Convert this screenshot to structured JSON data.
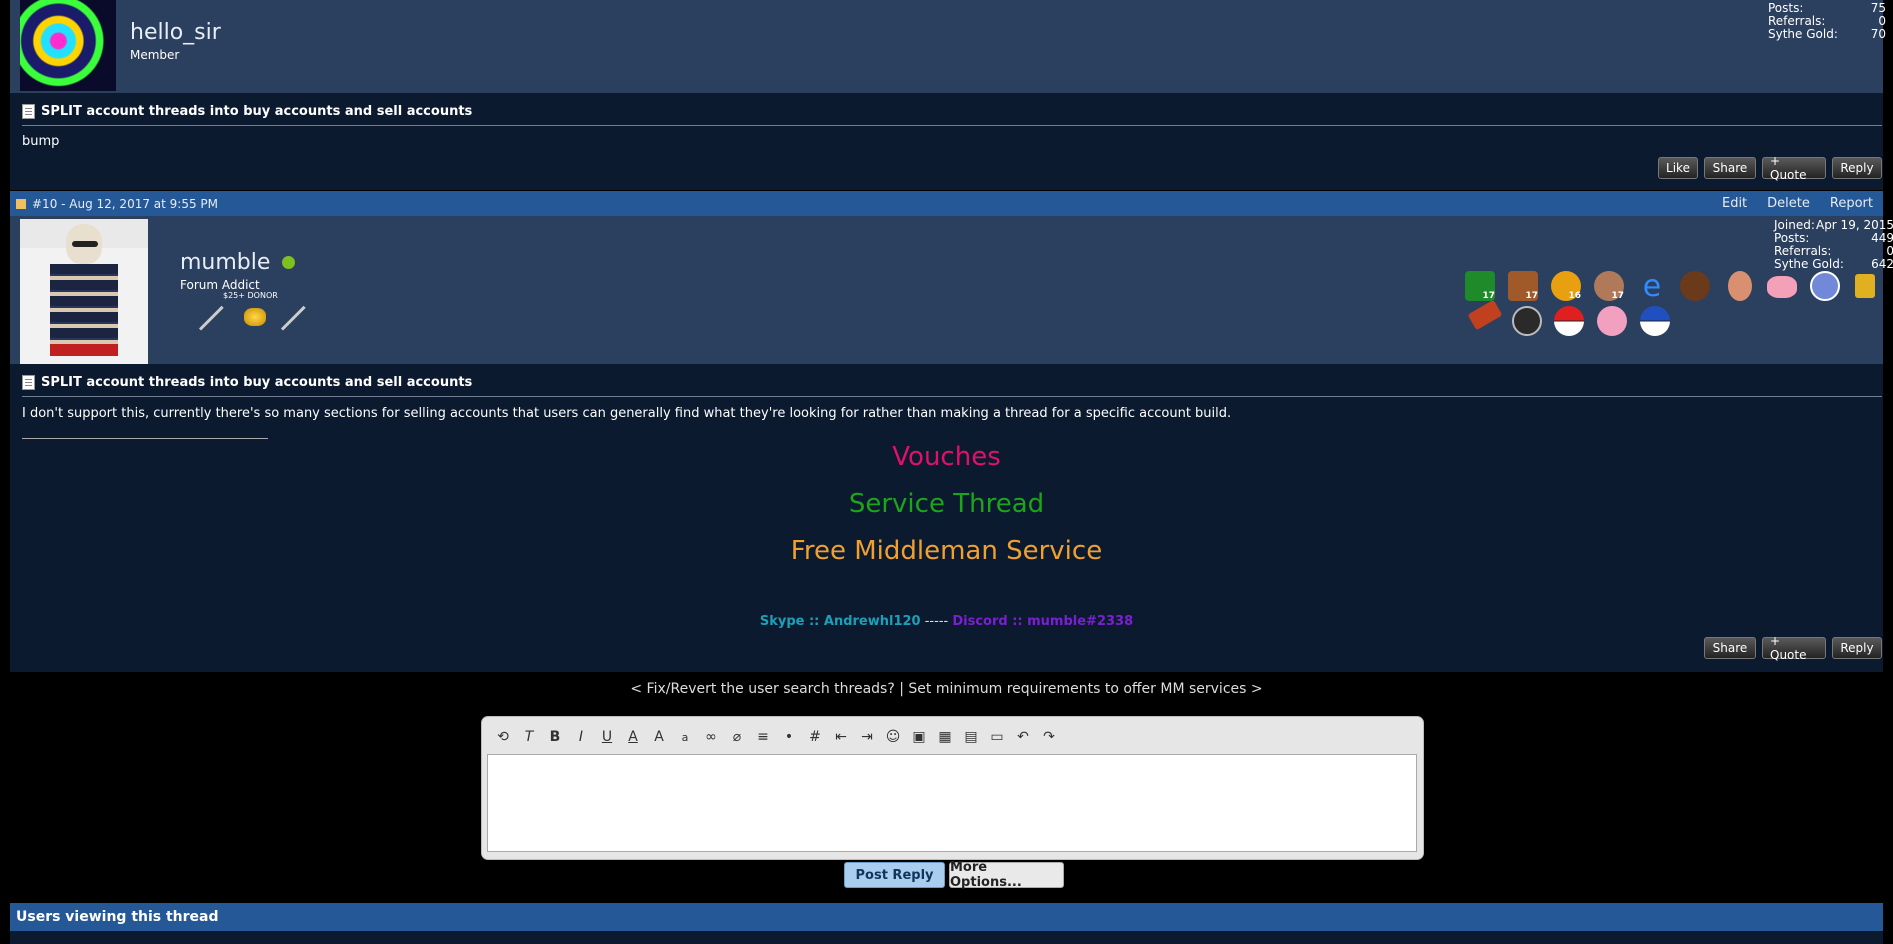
{
  "post9": {
    "username": "hello_sir",
    "rank": "Member",
    "stats": [
      {
        "label": "Posts:",
        "value": "75"
      },
      {
        "label": "Referrals:",
        "value": "0"
      },
      {
        "label": "Sythe Gold:",
        "value": "70"
      }
    ],
    "title": "SPLIT account threads into buy accounts and sell accounts",
    "body": "bump",
    "buttons": {
      "like": "Like",
      "share": "Share",
      "quote": "+ Quote",
      "reply": "Reply"
    }
  },
  "post10": {
    "header": "#10 - Aug 12, 2017 at 9:55 PM",
    "actions": {
      "edit": "Edit",
      "delete": "Delete",
      "report": "Report"
    },
    "username": "mumble",
    "rank": "Forum Addict",
    "donor_tag": "$25+ DONOR",
    "stats": [
      {
        "label": "Joined:",
        "value": "Apr 19, 2015"
      },
      {
        "label": "Posts:",
        "value": "449"
      },
      {
        "label": "Referrals:",
        "value": "0"
      },
      {
        "label": "Sythe Gold:",
        "value": "642"
      }
    ],
    "badge_counts": [
      "17",
      "17",
      "16",
      "17"
    ],
    "title": "SPLIT account threads into buy accounts and sell accounts",
    "body": "I don't support this, currently there's so many sections for selling accounts that users can generally find what they're looking for rather than making a thread for a specific account build.",
    "signature": {
      "line1": "Vouches",
      "line2": "Service Thread",
      "line3": "Free Middleman Service",
      "skype": "Skype :: Andrewhl120",
      "sep": " ----- ",
      "discord": "Discord :: mumble#2338"
    },
    "buttons": {
      "share": "Share",
      "quote": "+ Quote",
      "reply": "Reply"
    }
  },
  "nav": "< Fix/Revert the user search threads? | Set minimum requirements to offer MM services >",
  "editor": {
    "post_reply": "Post Reply",
    "more_options": "More Options..."
  },
  "viewers": {
    "title": "Users viewing this thread"
  },
  "colors": {
    "vouches": "#e0106b",
    "service": "#1aa51a",
    "middleman": "#f0a030",
    "skype": "#1aa0b8",
    "discord": "#7a20d0"
  }
}
